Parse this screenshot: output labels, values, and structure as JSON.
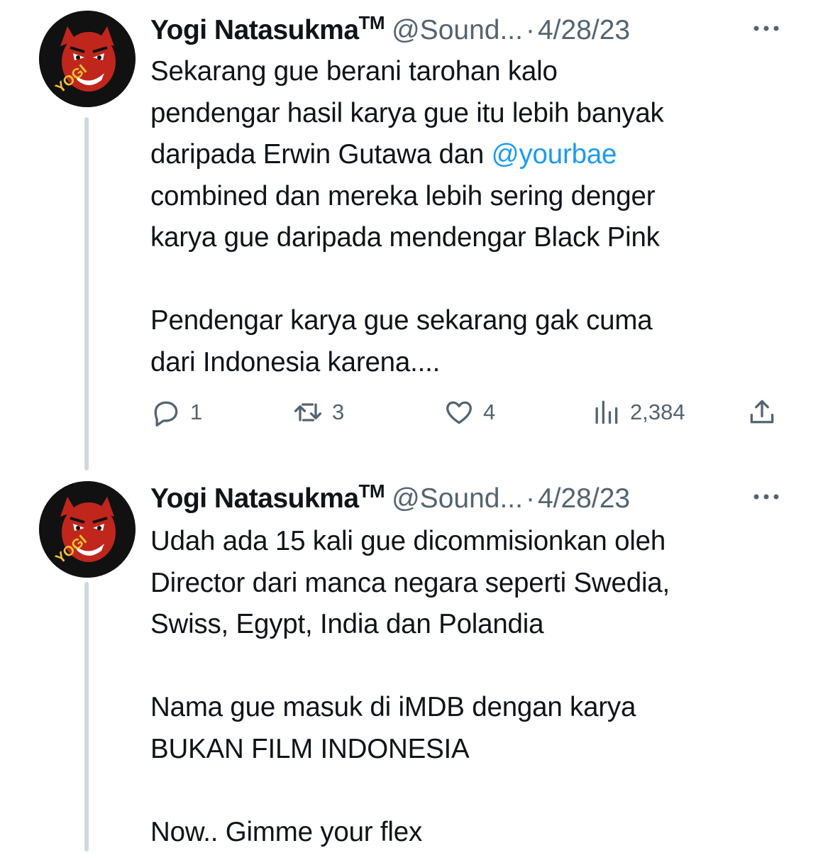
{
  "tweets": [
    {
      "author": {
        "display_name": "Yogi Natasukma",
        "tm": "TM",
        "handle": "@Sound...",
        "separator": "·",
        "date": "4/28/23",
        "avatar_text": "YOGI"
      },
      "body": {
        "lines": [
          "Sekarang gue berani tarohan kalo",
          "pendengar hasil karya gue itu lebih banyak",
          "daripada Erwin Gutawa dan ",
          "combined dan mereka lebih sering denger",
          "karya gue daripada mendengar Black Pink",
          "Pendengar karya gue sekarang gak cuma",
          "dari Indonesia karena...."
        ],
        "mention": "@yourbae"
      },
      "stats": {
        "replies": "1",
        "retweets": "3",
        "likes": "4",
        "views": "2,384"
      }
    },
    {
      "author": {
        "display_name": "Yogi Natasukma",
        "tm": "TM",
        "handle": "@Sound...",
        "separator": "·",
        "date": "4/28/23",
        "avatar_text": "YOGI"
      },
      "body": {
        "lines": [
          "Udah ada 15 kali gue dicommisionkan oleh",
          "Director dari manca negara seperti Swedia,",
          "Swiss, Egypt, India dan Polandia",
          "Nama gue masuk di iMDB dengan karya",
          "BUKAN FILM INDONESIA",
          "Now.. Gimme your flex"
        ]
      }
    }
  ],
  "icons": {
    "more": "more-horizontal-icon",
    "reply": "reply-bubble-icon",
    "retweet": "retweet-icon",
    "like": "heart-icon",
    "views": "views-bar-chart-icon",
    "share": "share-upload-icon"
  },
  "colors": {
    "text": "#0f1419",
    "secondary": "#536471",
    "mention": "#1d9bf0",
    "thread_line": "#cfd9de",
    "avatar_bg": "#111111",
    "avatar_devil": "#c0261c"
  }
}
